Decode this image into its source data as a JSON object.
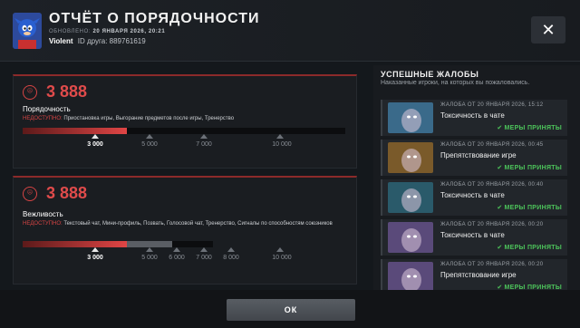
{
  "header": {
    "title": "ОТЧЁТ О ПОРЯДОЧНОСТИ",
    "updated_label": "ОБНОВЛЕНО:",
    "updated_value": "20 ЯНВАРЯ 2026, 20:21",
    "username": "Violent",
    "friend_id": "ID друга: 889761619",
    "close_icon": "close-icon"
  },
  "cards": [
    {
      "icon": "conduct-shield-icon",
      "value": "3 888",
      "label": "Порядочность",
      "unavailable_prefix": "НЕДОСТУПНО:",
      "unavailable_text": " Приостановка игры, Выгорание предметов после игры, Тренерство",
      "ticks": [
        {
          "label": "3 000",
          "active": true
        },
        {
          "label": "5 000",
          "active": false
        },
        {
          "label": "7 000",
          "active": false
        },
        {
          "label": "10 000",
          "active": false
        }
      ]
    },
    {
      "icon": "conduct-shield-icon",
      "value": "3 888",
      "label": "Вежливость",
      "unavailable_prefix": "НЕДОСТУПНО:",
      "unavailable_text": " Текстовый чат, Мини-профиль, Позвать, Голосовой чат, Тренерство, Сигналы по способностям союзников",
      "ticks": [
        {
          "label": "3 000",
          "active": true
        },
        {
          "label": "5 000",
          "active": false
        },
        {
          "label": "6 000",
          "active": false
        },
        {
          "label": "7 000",
          "active": false
        },
        {
          "label": "8 000",
          "active": false
        },
        {
          "label": "10 000",
          "active": false
        }
      ]
    }
  ],
  "reports_panel": {
    "title": "УСПЕШНЫЕ ЖАЛОБЫ",
    "subtitle": "Наказанные игроки, на которых вы пожаловались.",
    "items": [
      {
        "meta": "ЖАЛОБА ОТ 20 ЯНВАРЯ 2026, 15:12",
        "reason": "Токсичность в чате",
        "status": "МЕРЫ ПРИНЯТЫ",
        "thumb_color": "#3a6a8a"
      },
      {
        "meta": "ЖАЛОБА ОТ 20 ЯНВАРЯ 2026, 00:45",
        "reason": "Препятствование игре",
        "status": "МЕРЫ ПРИНЯТЫ",
        "thumb_color": "#7a5a2a"
      },
      {
        "meta": "ЖАЛОБА ОТ 20 ЯНВАРЯ 2026, 00:40",
        "reason": "Токсичность в чате",
        "status": "МЕРЫ ПРИНЯТЫ",
        "thumb_color": "#2a5a6a"
      },
      {
        "meta": "ЖАЛОБА ОТ 20 ЯНВАРЯ 2026, 00:20",
        "reason": "Токсичность в чате",
        "status": "МЕРЫ ПРИНЯТЫ",
        "thumb_color": "#5a4a7a"
      },
      {
        "meta": "ЖАЛОБА ОТ 20 ЯНВАРЯ 2026, 00:20",
        "reason": "Препятствование игре",
        "status": "МЕРЫ ПРИНЯТЫ",
        "thumb_color": "#5a4a7a"
      }
    ]
  },
  "footer": {
    "ok_label": "ОК"
  },
  "colors": {
    "accent_red": "#e04b4b",
    "success_green": "#4cc35a"
  }
}
